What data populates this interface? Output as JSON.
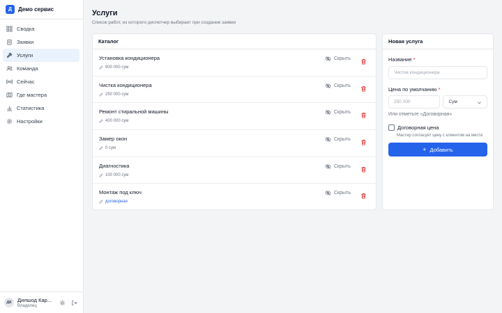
{
  "brand": {
    "logo_letter": "Д",
    "name": "Демо сервис"
  },
  "nav": [
    {
      "label": "Сводка",
      "icon": "grid-icon"
    },
    {
      "label": "Заявки",
      "icon": "clipboard-icon"
    },
    {
      "label": "Услуги",
      "icon": "wrench-icon",
      "active": true
    },
    {
      "label": "Команда",
      "icon": "users-icon"
    },
    {
      "label": "Сейчас",
      "icon": "radio-icon"
    },
    {
      "label": "Где мастера",
      "icon": "map-icon"
    },
    {
      "label": "Статистика",
      "icon": "bar-chart-icon"
    },
    {
      "label": "Настройки",
      "icon": "gear-icon"
    }
  ],
  "user": {
    "initials": "ДК",
    "name": "Дилшод Кар...",
    "role": "Владелец"
  },
  "page": {
    "title": "Услуги",
    "subtitle": "Список работ, из которого диспетчер выбирает при создании заявки"
  },
  "catalog": {
    "title": "Каталог",
    "hide_label": "Скрыть",
    "items": [
      {
        "name": "Установка кондиционера",
        "price": "900 000 сум"
      },
      {
        "name": "Чистка кондиционера",
        "price": "250 000 сум"
      },
      {
        "name": "Ремонт стиральной машины",
        "price": "400 000 сум"
      },
      {
        "name": "Замер окон",
        "price": "0 сум"
      },
      {
        "name": "Диагностика",
        "price": "100 000 сум"
      },
      {
        "name": "Монтаж под ключ",
        "price": "договорная"
      }
    ]
  },
  "form": {
    "title": "Новая услуга",
    "name_label": "Название",
    "name_placeholder": "Чистка кондиционера",
    "price_label": "Цена по умолчанию",
    "price_placeholder": "250 000",
    "currency": "Сум",
    "or_hint": "Или отметьте «Договорная»",
    "negotiable_label": "Договорная цена",
    "negotiable_hint": "Мастер согласует цену с клиентом на месте",
    "submit_label": "Добавить",
    "required_mark": "*"
  },
  "colors": {
    "accent": "#2563eb",
    "danger": "#dc2626",
    "active_bg": "#eaf2fd"
  }
}
